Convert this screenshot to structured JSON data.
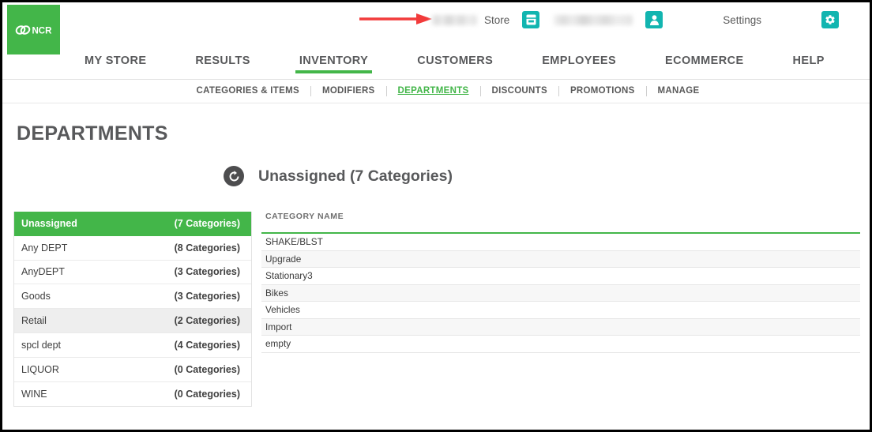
{
  "brand": {
    "logo_text": "NCR",
    "logo_color": "#43b649"
  },
  "header": {
    "store_name_blurred": "",
    "store_label": "Store",
    "user_name_blurred": "",
    "settings_label": "Settings",
    "icons": {
      "register": "register-icon",
      "user": "user-icon",
      "gear": "gear-icon"
    },
    "annotation": {
      "type": "red-arrow",
      "color": "#f23b3b",
      "points_to": "store-name"
    }
  },
  "main_nav": {
    "items": [
      {
        "label": "MY STORE",
        "active": false
      },
      {
        "label": "RESULTS",
        "active": false
      },
      {
        "label": "INVENTORY",
        "active": true
      },
      {
        "label": "CUSTOMERS",
        "active": false
      },
      {
        "label": "EMPLOYEES",
        "active": false
      },
      {
        "label": "ECOMMERCE",
        "active": false
      },
      {
        "label": "HELP",
        "active": false
      }
    ],
    "active_accent": "#43b649"
  },
  "sub_nav": {
    "items": [
      {
        "label": "CATEGORIES & ITEMS",
        "active": false
      },
      {
        "label": "MODIFIERS",
        "active": false
      },
      {
        "label": "DEPARTMENTS",
        "active": true
      },
      {
        "label": "DISCOUNTS",
        "active": false
      },
      {
        "label": "PROMOTIONS",
        "active": false
      },
      {
        "label": "MANAGE",
        "active": false
      }
    ]
  },
  "page": {
    "title": "DEPARTMENTS",
    "section_title": "Unassigned (7 Categories)",
    "back_icon": "back-circle-icon"
  },
  "departments": {
    "rows": [
      {
        "name": "Unassigned",
        "count": "(7 Categories)",
        "state": "selected"
      },
      {
        "name": "Any DEPT",
        "count": "(8 Categories)",
        "state": "normal"
      },
      {
        "name": "AnyDEPT",
        "count": "(3 Categories)",
        "state": "normal"
      },
      {
        "name": "Goods",
        "count": "(3 Categories)",
        "state": "normal"
      },
      {
        "name": "Retail",
        "count": "(2 Categories)",
        "state": "hovered"
      },
      {
        "name": "spcl dept",
        "count": "(4 Categories)",
        "state": "normal"
      },
      {
        "name": "LIQUOR",
        "count": "(0 Categories)",
        "state": "normal"
      },
      {
        "name": "WINE",
        "count": "(0 Categories)",
        "state": "normal"
      }
    ]
  },
  "categories": {
    "column_header": "CATEGORY NAME",
    "rows": [
      {
        "name": "SHAKE/BLST"
      },
      {
        "name": "Upgrade"
      },
      {
        "name": "Stationary3"
      },
      {
        "name": "Bikes"
      },
      {
        "name": "Vehicles"
      },
      {
        "name": "Import"
      },
      {
        "name": "empty"
      }
    ]
  }
}
